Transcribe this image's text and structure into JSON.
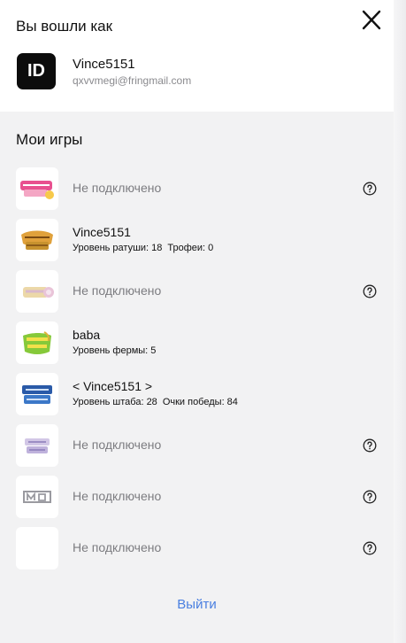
{
  "header": {
    "signed_in_label": "Вы вошли как",
    "close_icon": "close-icon"
  },
  "account": {
    "avatar_text": "ID",
    "username": "Vince5151",
    "email": "qxvvmegi@fringmail.com"
  },
  "games_section": {
    "title": "Мои игры",
    "games": [
      {
        "icon": "brawl-stars-logo-icon",
        "status": "Не подключено"
      },
      {
        "icon": "clash-of-clans-logo-icon",
        "player": "Vince5151",
        "stat1": "Уровень ратуши: 18",
        "stat2": "Трофеи: 0"
      },
      {
        "icon": "clash-royale-logo-icon",
        "status": "Не подключено"
      },
      {
        "icon": "hay-day-logo-icon",
        "player": "baba",
        "stat1": "Уровень фермы: 5"
      },
      {
        "icon": "boom-beach-logo-icon",
        "player": "< Vince5151 >",
        "stat1": "Уровень штаба: 28",
        "stat2": "Очки победы: 84"
      },
      {
        "icon": "squad-busters-logo-icon",
        "status": "Не подключено"
      },
      {
        "icon": "mo-co-logo-icon",
        "status": "Не подключено"
      },
      {
        "icon": "blank-game-icon",
        "status": "Не подключено"
      }
    ]
  },
  "footer": {
    "logout_label": "Выйти",
    "accent_color": "#4a7fe0"
  }
}
